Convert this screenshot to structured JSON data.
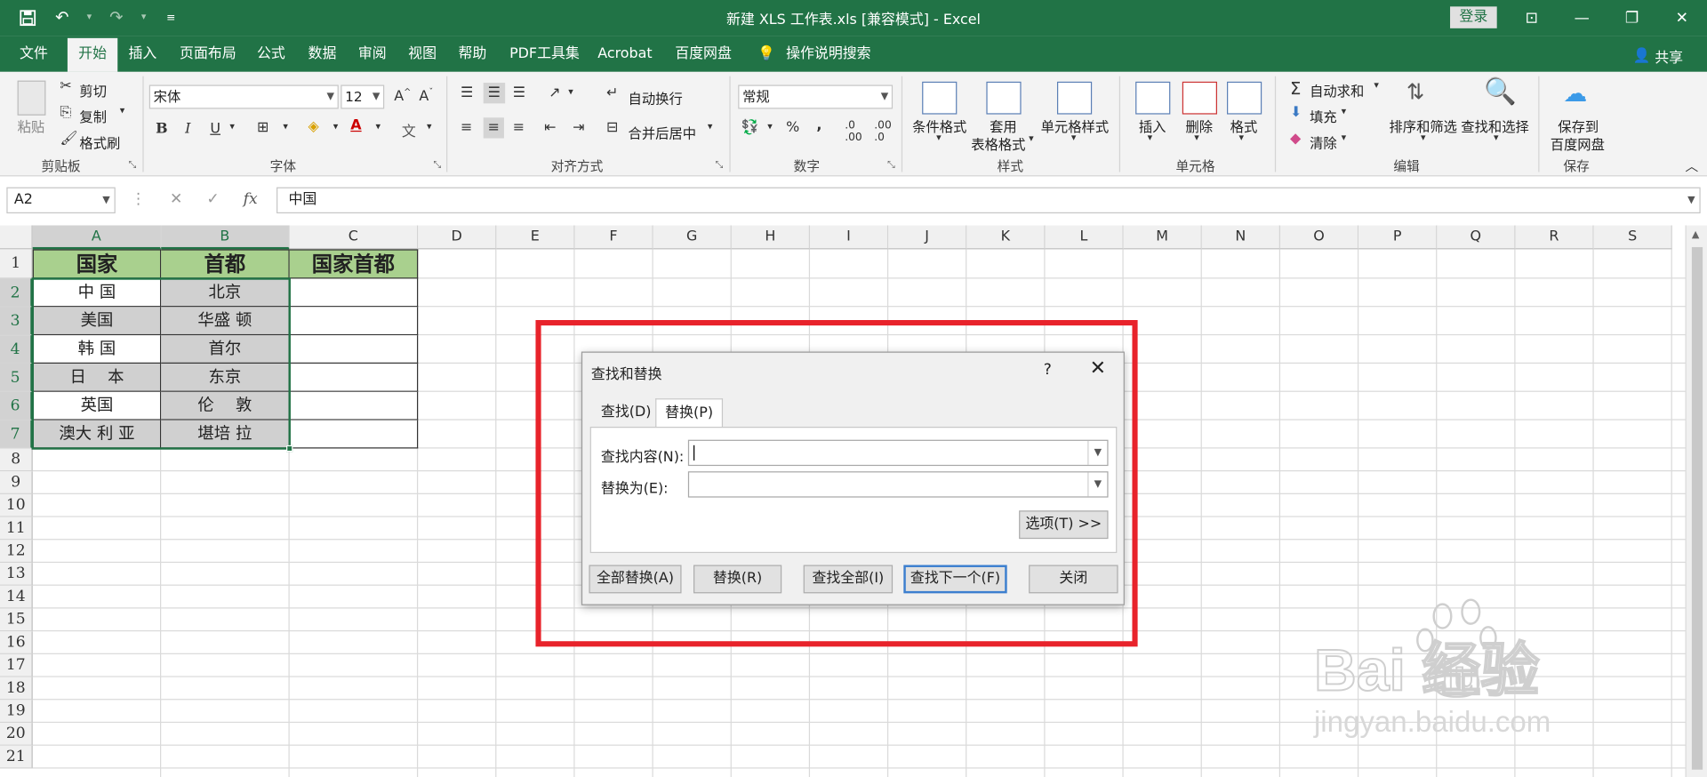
{
  "window": {
    "title": "新建 XLS 工作表.xls  [兼容模式]  -  Excel",
    "login": "登录",
    "share": "共享"
  },
  "tabs": [
    "文件",
    "开始",
    "插入",
    "页面布局",
    "公式",
    "数据",
    "审阅",
    "视图",
    "帮助",
    "PDF工具集",
    "Acrobat",
    "百度网盘",
    "操作说明搜索"
  ],
  "ribbon": {
    "clipboard": {
      "paste": "粘贴",
      "cut": "剪切",
      "copy": "复制",
      "format_painter": "格式刷",
      "label": "剪贴板"
    },
    "font": {
      "name": "宋体",
      "size": "12",
      "label": "字体"
    },
    "alignment": {
      "wrap": "自动换行",
      "merge": "合并后居中",
      "label": "对齐方式"
    },
    "number": {
      "format": "常规",
      "label": "数字"
    },
    "styles": {
      "cond": "条件格式",
      "table1": "套用",
      "table2": "表格格式",
      "cell": "单元格样式",
      "label": "样式"
    },
    "cells": {
      "insert": "插入",
      "delete": "删除",
      "format": "格式",
      "label": "单元格"
    },
    "editing": {
      "autosum": "自动求和",
      "fill": "填充",
      "clear": "清除",
      "sort": "排序和筛选",
      "find": "查找和选择",
      "label": "编辑"
    },
    "save": {
      "line1": "保存到",
      "line2": "百度网盘",
      "label": "保存"
    }
  },
  "formula_bar": {
    "name_box": "A2",
    "formula": "中国"
  },
  "columns": [
    "A",
    "B",
    "C",
    "D",
    "E",
    "F",
    "G",
    "H",
    "I",
    "J",
    "K",
    "L",
    "M",
    "N",
    "O",
    "P",
    "Q",
    "R",
    "S"
  ],
  "rows": [
    "1",
    "2",
    "3",
    "4",
    "5",
    "6",
    "7",
    "8",
    "9",
    "10",
    "11",
    "12",
    "13",
    "14",
    "15",
    "16",
    "17",
    "18",
    "19",
    "20",
    "21"
  ],
  "sheet": {
    "headers": [
      "国家",
      "首都",
      "国家首都"
    ],
    "data": [
      [
        "中 国",
        "北京"
      ],
      [
        "美国",
        "华盛 顿"
      ],
      [
        "韩 国",
        "首尔"
      ],
      [
        "日　 本",
        "东京"
      ],
      [
        "英国",
        "伦　 敦"
      ],
      [
        "澳大 利 亚",
        "堪培 拉"
      ]
    ]
  },
  "dialog": {
    "title": "查找和替换",
    "help": "?",
    "tab_find": "查找(D)",
    "tab_replace": "替换(P)",
    "find_label": "查找内容(N):",
    "replace_label": "替换为(E):",
    "find_value": "",
    "replace_value": "",
    "options": "选项(T) >>",
    "replace_all": "全部替换(A)",
    "replace": "替换(R)",
    "find_all": "查找全部(I)",
    "find_next": "查找下一个(F)",
    "close": "关闭"
  },
  "watermark": {
    "logo": "Bai du 经验",
    "url": "jingyan.baidu.com"
  },
  "colors": {
    "excel_green": "#217346",
    "header_fill": "#a9d08e",
    "gray_fill": "#d0d0d0",
    "annotation_red": "#e8232b"
  }
}
